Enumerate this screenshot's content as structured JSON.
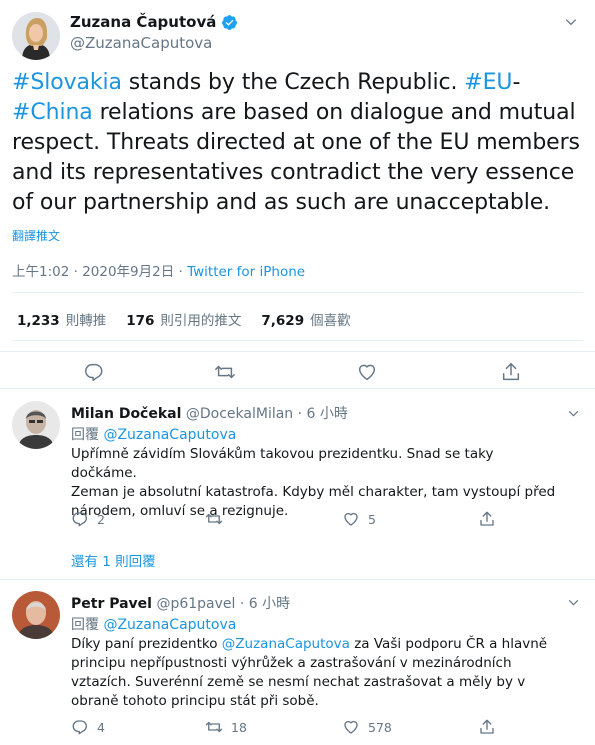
{
  "main_tweet": {
    "author_name": "Zuzana Čaputová",
    "author_handle": "@ZuzanaCaputova",
    "text_parts": [
      {
        "t": "#Slovakia",
        "link": true
      },
      {
        "t": " stands by the Czech Republic. ",
        "link": false
      },
      {
        "t": "#EU",
        "link": true
      },
      {
        "t": "-",
        "link": false
      },
      {
        "t": "#China",
        "link": true
      },
      {
        "t": " relations are based on dialogue and mutual respect. Threats directed at one of the EU members and its representatives contradict the very essence of our partnership and as such are unacceptable.",
        "link": false
      }
    ],
    "translate_label": "翻譯推文",
    "timestamp": "上午1:02 · 2020年9月2日",
    "source_separator": " · ",
    "source": "Twitter for iPhone",
    "stats": [
      {
        "value": "1,233",
        "label": "則轉推"
      },
      {
        "value": "176",
        "label": "則引用的推文"
      },
      {
        "value": "7,629",
        "label": "個喜歡"
      }
    ]
  },
  "replies": [
    {
      "name": "Milan Dočekal",
      "handle": "@DocekalMilan",
      "time_sep": " · ",
      "time": "6 小時",
      "reply_prefix": "回覆",
      "reply_to": "@ZuzanaCaputova",
      "text_lines": [
        "Upřímně závidím Slovákům takovou prezidentku. Snad se taky dočkáme.",
        "Zeman je absolutní katastrofa. Kdyby měl charakter, tam vystoupí před",
        "národem, omluví se a rezignuje."
      ],
      "reply_count": "2",
      "retweet_count": "",
      "like_count": "5",
      "thread_label": "還有 1 則回覆"
    },
    {
      "name": "Petr Pavel",
      "handle": "@p61pavel",
      "time_sep": " · ",
      "time": "6 小時",
      "reply_prefix": "回覆",
      "reply_to": "@ZuzanaCaputova",
      "text_lines": [
        "Díky paní prezidentko ",
        "@ZuzanaCaputova",
        " za Vaši podporu ČR a hlavně",
        "principu nepřípustnosti výhrůžek a zastrašování v mezinárodních",
        "vztazích. Suverénní země se nesmí nechat zastrašovat a měly by v",
        "obraně tohoto principu stát při sobě."
      ],
      "reply_count": "4",
      "retweet_count": "18",
      "like_count": "578"
    }
  ],
  "colors": {
    "accent": "#1b95e0",
    "muted": "#657786",
    "text": "#14171a",
    "divider": "#e6ecf0"
  },
  "icons": [
    "verified-badge-icon",
    "chevron-down-icon",
    "reply-icon",
    "retweet-icon",
    "like-icon",
    "share-icon"
  ]
}
